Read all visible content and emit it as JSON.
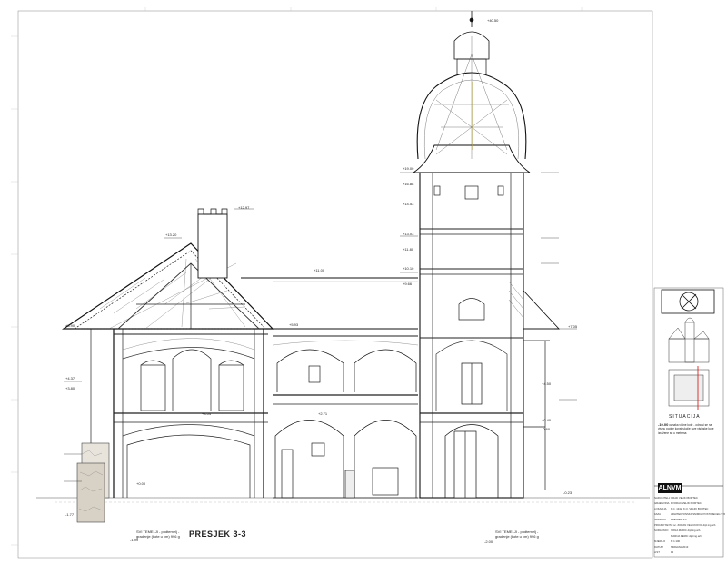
{
  "drawing": {
    "section_title": "PRESJEK 3-3",
    "situation_label": "SITUACIJA",
    "legend_mark": "-10.00",
    "legend_text": "oznaka visine kote - odnosi se na visinu podne konstrukcije; sve visinske kote izražene su u metrima",
    "scale_note_left": "SVI TEMELJI - podtemelj - gradenje (kote u cm) 996 g",
    "scale_note_right": "SVI TEMELJI - podtemelj - gradenje (kote u cm) 996 g"
  },
  "elevations": {
    "tower_top": "+40.50",
    "tower_1": "+19.00",
    "tower_2": "+16.88",
    "tower_3": "+14.53",
    "tower_4": "+13.03",
    "tower_5": "+11.80",
    "tower_6": "+10.10",
    "tower_7": "+9.66",
    "left_roof_top": "+13.20",
    "chimney_top": "+12.97",
    "roof_mid": "+11.00",
    "eave_left": "+5.90",
    "eave_right": "+5.93",
    "floor_1": "+4.37",
    "floor_2": "+3.80",
    "floor_3": "+3.04",
    "floor_4": "+2.71",
    "ground": "+0.00",
    "base_left": "-1.77",
    "base_right": "-0.23",
    "foundation_left": "-1.99",
    "foundation_right": "-2.00",
    "right_1": "+7.05",
    "right_2": "+4.50",
    "right_3": "+0.40",
    "right_4": "-0.60"
  },
  "title_block": {
    "logo": "ALNVM",
    "rows": [
      {
        "k": "NARUČITELJ",
        "v": "GRAD VELIKI BORTEC"
      },
      {
        "k": "GRAĐEVINA",
        "v": "DVORAC VELIKI BORTEC"
      },
      {
        "k": "LOKACIJA",
        "v": "K.Č. 1342, K.O. VELIKI BORTEC"
      },
      {
        "k": "FAZA",
        "v": "ARHITEKTONSKA SNIMKA POSTOJEĆEG STANJA"
      },
      {
        "k": "SADRŽAJ",
        "v": "PRESJEK 3-3"
      },
      {
        "k": "PROJEKTANT",
        "v": "dr.sc. ZORAN VELIČKOVIĆ dipl.ing.arh."
      },
      {
        "k": "SURADNICI",
        "v": "IVANA MARIĆ dipl.ing.arh."
      },
      {
        "k": "",
        "v": "MARIJA PERIĆ dipl.ing.arh."
      },
      {
        "k": "MJERILO",
        "v": "M 1:100"
      },
      {
        "k": "DATUM",
        "v": "TRAVANJ 2013"
      },
      {
        "k": "LIST",
        "v": "14"
      }
    ]
  }
}
